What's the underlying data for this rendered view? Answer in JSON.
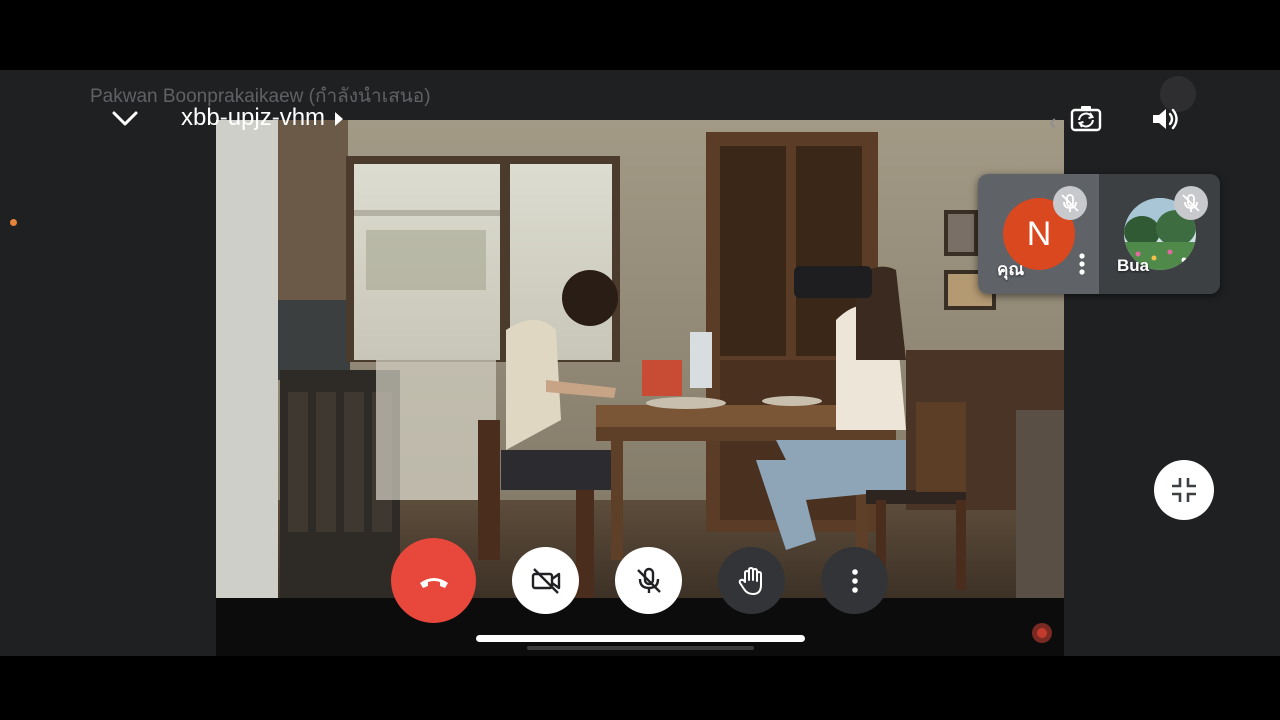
{
  "presenter": {
    "name_line": "Pakwan Boonprakaikaew (กำลังนำเสนอ)"
  },
  "meeting": {
    "code": "xbb-upjz-vhm"
  },
  "top_controls": {
    "collapse_icon": "chevron-down-icon",
    "switch_camera_icon": "camera-switch-icon",
    "speaker_icon": "speaker-icon"
  },
  "participants": [
    {
      "name": "คุณ",
      "avatar_letter": "N",
      "avatar_color": "#d9481f",
      "muted": true,
      "is_self": true
    },
    {
      "name": "Bua",
      "avatar_letter": "",
      "muted": true,
      "is_self": false
    }
  ],
  "controls": {
    "end_call_color": "#e8473c",
    "camera_state": "off",
    "mic_state": "off"
  },
  "colors": {
    "surface": "#1f2022",
    "accent_orange": "#e8843a"
  }
}
